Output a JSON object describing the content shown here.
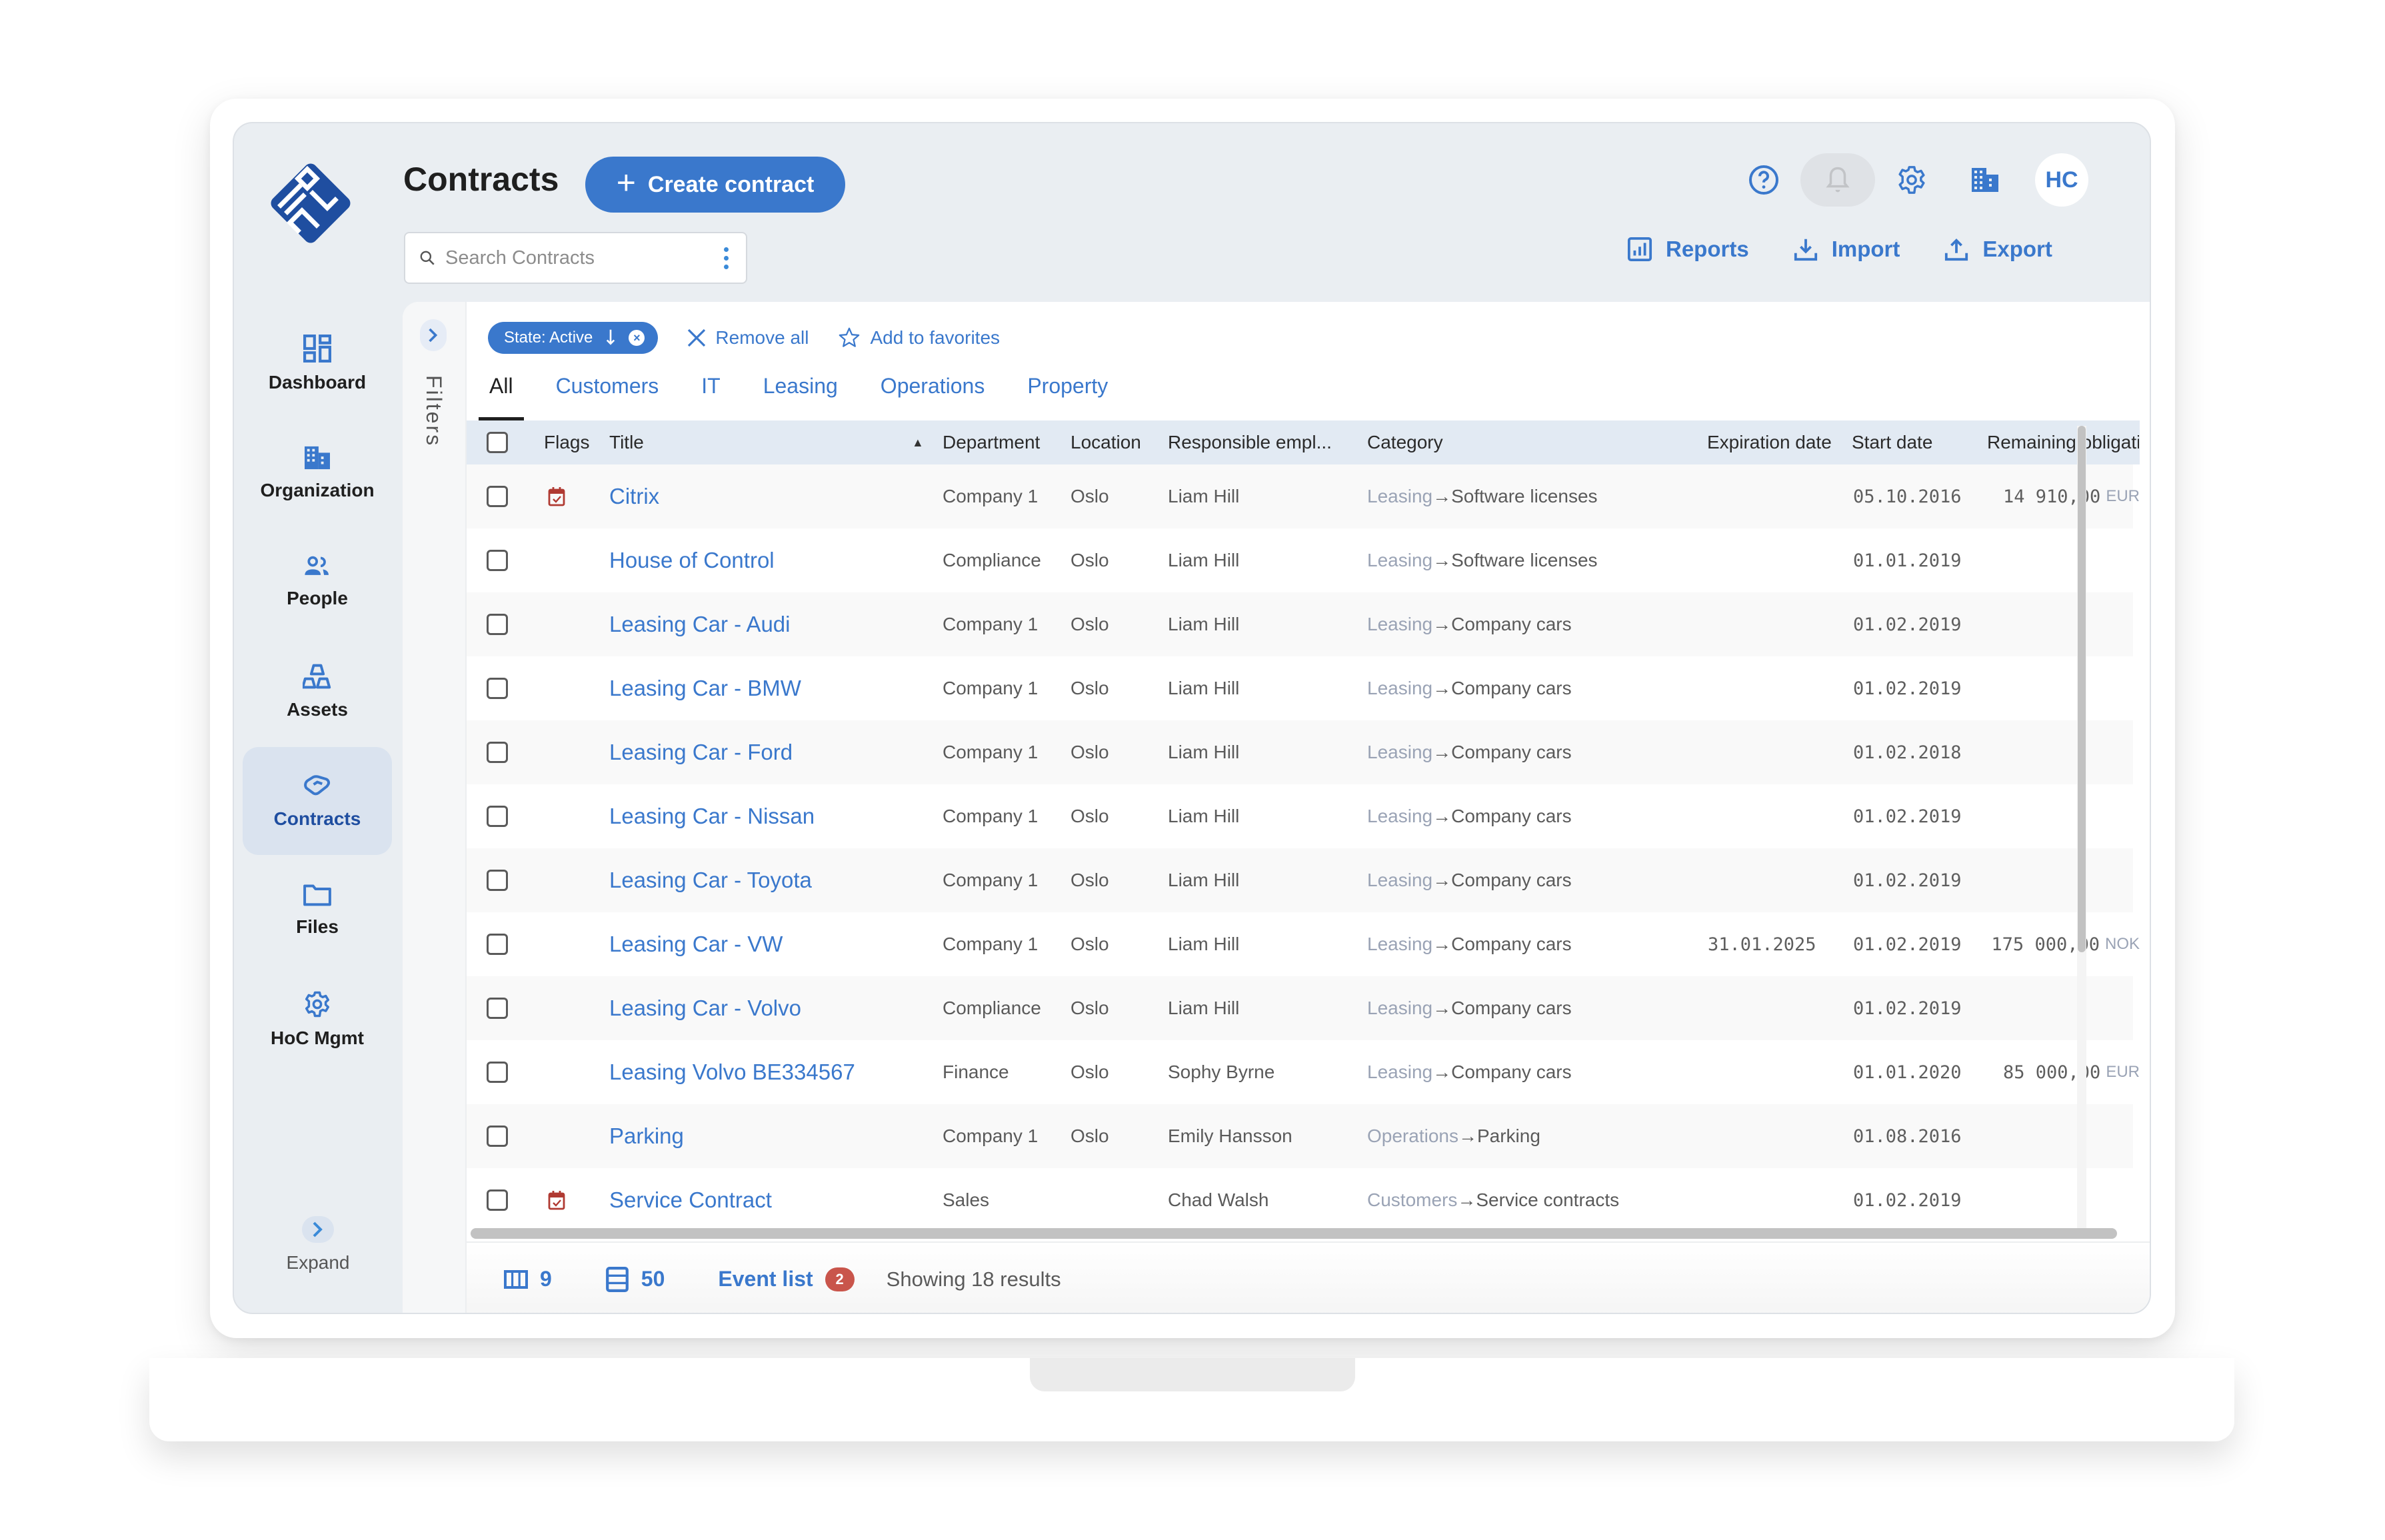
{
  "app": {
    "page_title": "Contracts",
    "create_button": "Create contract",
    "search_placeholder": "Search Contracts",
    "avatar_initials": "HC",
    "colors": {
      "accent": "#3a78cc",
      "logo": "#1f4ea0",
      "badge": "#c9554b",
      "flag": "#b03a32"
    }
  },
  "header_actions": [
    {
      "label": "Reports",
      "icon": "reports-icon"
    },
    {
      "label": "Import",
      "icon": "import-icon"
    },
    {
      "label": "Export",
      "icon": "export-icon"
    }
  ],
  "top_icons": [
    "help-icon",
    "bell-icon",
    "gear-icon",
    "building-icon"
  ],
  "sidebar": {
    "items": [
      {
        "label": "Dashboard",
        "icon": "dashboard-icon",
        "active": false
      },
      {
        "label": "Organization",
        "icon": "building-icon",
        "active": false
      },
      {
        "label": "People",
        "icon": "people-icon",
        "active": false
      },
      {
        "label": "Assets",
        "icon": "assets-icon",
        "active": false
      },
      {
        "label": "Contracts",
        "icon": "handshake-icon",
        "active": true
      },
      {
        "label": "Files",
        "icon": "folder-icon",
        "active": false
      },
      {
        "label": "HoC Mgmt",
        "icon": "gear-icon",
        "active": false
      }
    ],
    "expand_label": "Expand"
  },
  "filters": {
    "rail_label": "Filters",
    "chip_label": "State: Active",
    "remove_all": "Remove all",
    "add_favorites": "Add to favorites"
  },
  "tabs": [
    {
      "label": "All",
      "active": true
    },
    {
      "label": "Customers",
      "active": false
    },
    {
      "label": "IT",
      "active": false
    },
    {
      "label": "Leasing",
      "active": false
    },
    {
      "label": "Operations",
      "active": false
    },
    {
      "label": "Property",
      "active": false
    }
  ],
  "table": {
    "columns": [
      "Flags",
      "Title",
      "Department",
      "Location",
      "Responsible empl...",
      "Category",
      "Expiration date",
      "Start date",
      "Remaining obligati..."
    ],
    "sort_indicator": "▲",
    "rows": [
      {
        "flag": true,
        "title": "Citrix",
        "department": "Company 1",
        "location": "Oslo",
        "responsible": "Liam Hill",
        "category_parent": "Leasing",
        "category": "Software licenses",
        "expiration": "",
        "start": "05.10.2016",
        "remaining": "14 910,00",
        "currency": "EUR"
      },
      {
        "flag": false,
        "title": "House of Control",
        "department": "Compliance",
        "location": "Oslo",
        "responsible": "Liam Hill",
        "category_parent": "Leasing",
        "category": "Software licenses",
        "expiration": "",
        "start": "01.01.2019",
        "remaining": "",
        "currency": ""
      },
      {
        "flag": false,
        "title": "Leasing Car - Audi",
        "department": "Company 1",
        "location": "Oslo",
        "responsible": "Liam Hill",
        "category_parent": "Leasing",
        "category": "Company cars",
        "expiration": "",
        "start": "01.02.2019",
        "remaining": "",
        "currency": ""
      },
      {
        "flag": false,
        "title": "Leasing Car - BMW",
        "department": "Company 1",
        "location": "Oslo",
        "responsible": "Liam Hill",
        "category_parent": "Leasing",
        "category": "Company cars",
        "expiration": "",
        "start": "01.02.2019",
        "remaining": "",
        "currency": ""
      },
      {
        "flag": false,
        "title": "Leasing Car - Ford",
        "department": "Company 1",
        "location": "Oslo",
        "responsible": "Liam Hill",
        "category_parent": "Leasing",
        "category": "Company cars",
        "expiration": "",
        "start": "01.02.2018",
        "remaining": "",
        "currency": ""
      },
      {
        "flag": false,
        "title": "Leasing Car - Nissan",
        "department": "Company 1",
        "location": "Oslo",
        "responsible": "Liam Hill",
        "category_parent": "Leasing",
        "category": "Company cars",
        "expiration": "",
        "start": "01.02.2019",
        "remaining": "",
        "currency": ""
      },
      {
        "flag": false,
        "title": "Leasing Car - Toyota",
        "department": "Company 1",
        "location": "Oslo",
        "responsible": "Liam Hill",
        "category_parent": "Leasing",
        "category": "Company cars",
        "expiration": "",
        "start": "01.02.2019",
        "remaining": "",
        "currency": ""
      },
      {
        "flag": false,
        "title": "Leasing Car - VW",
        "department": "Company 1",
        "location": "Oslo",
        "responsible": "Liam Hill",
        "category_parent": "Leasing",
        "category": "Company cars",
        "expiration": "31.01.2025",
        "start": "01.02.2019",
        "remaining": "175 000,00",
        "currency": "NOK"
      },
      {
        "flag": false,
        "title": "Leasing Car - Volvo",
        "department": "Compliance",
        "location": "Oslo",
        "responsible": "Liam Hill",
        "category_parent": "Leasing",
        "category": "Company cars",
        "expiration": "",
        "start": "01.02.2019",
        "remaining": "",
        "currency": ""
      },
      {
        "flag": false,
        "title": "Leasing Volvo BE334567",
        "department": "Finance",
        "location": "Oslo",
        "responsible": "Sophy Byrne",
        "category_parent": "Leasing",
        "category": "Company cars",
        "expiration": "",
        "start": "01.01.2020",
        "remaining": "85 000,00",
        "currency": "EUR"
      },
      {
        "flag": false,
        "title": "Parking",
        "department": "Company 1",
        "location": "Oslo",
        "responsible": "Emily Hansson",
        "category_parent": "Operations",
        "category": "Parking",
        "expiration": "",
        "start": "01.08.2016",
        "remaining": "",
        "currency": ""
      },
      {
        "flag": true,
        "title": "Service Contract",
        "department": "Sales",
        "location": "",
        "responsible": "Chad Walsh",
        "category_parent": "Customers",
        "category": "Service contracts",
        "expiration": "",
        "start": "01.02.2019",
        "remaining": "",
        "currency": ""
      }
    ]
  },
  "footer": {
    "columns_count": "9",
    "page_size": "50",
    "event_list_label": "Event list",
    "event_badge": "2",
    "results_text": "Showing 18 results"
  }
}
